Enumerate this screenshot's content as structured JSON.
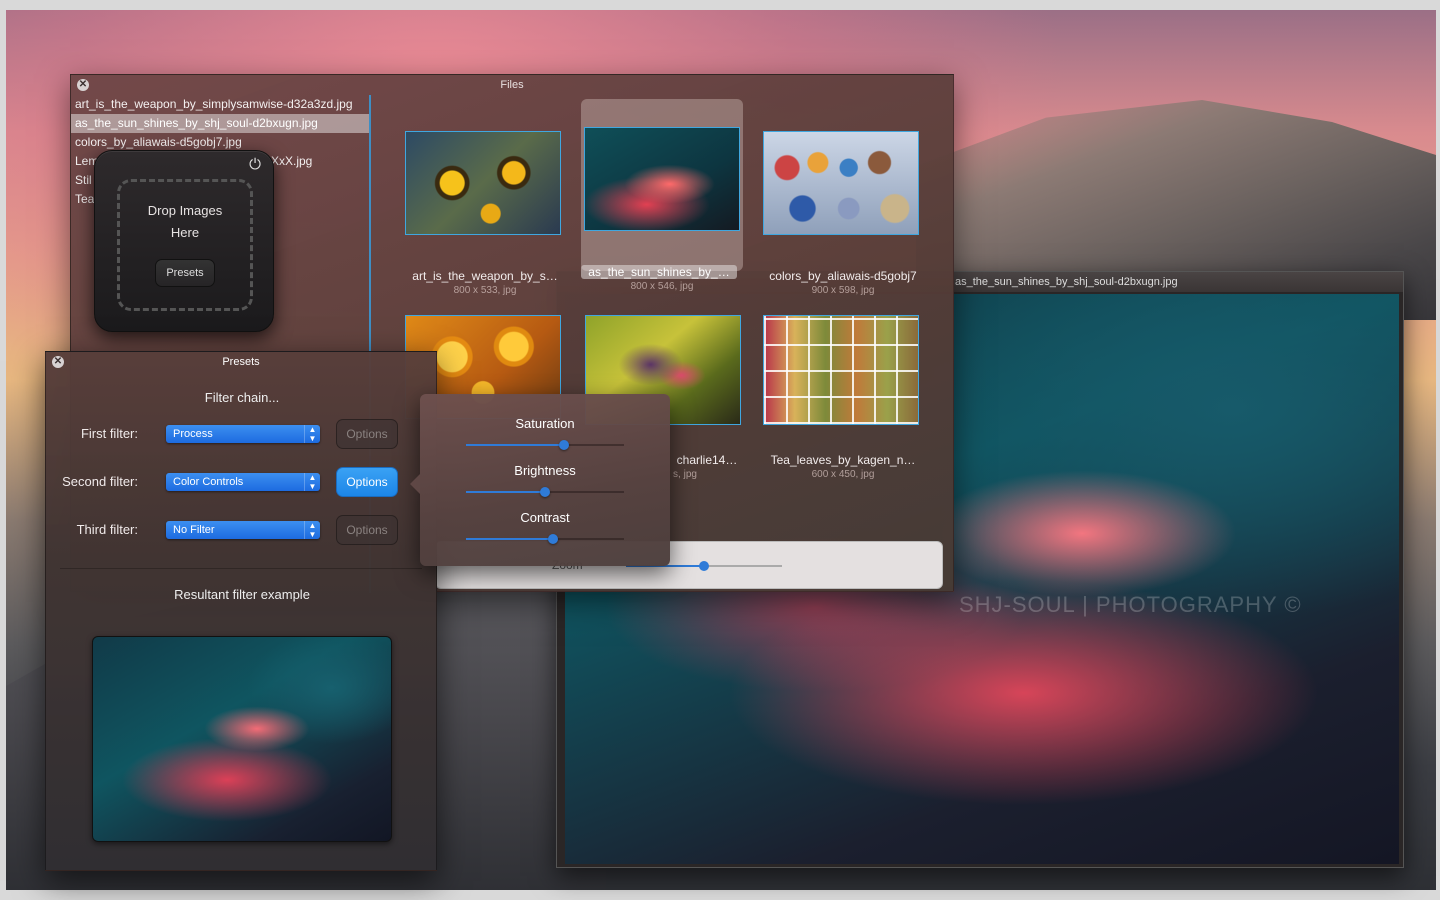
{
  "viewer": {
    "title": "as_the_sun_shines_by_shj_soul-d2bxugn.jpg",
    "watermark": "SHJ-SOUL | PHOTOGRAPHY ©"
  },
  "files_window": {
    "title": "Files",
    "files": [
      "art_is_the_weapon_by_simplysamwise-d32a3zd.jpg",
      "as_the_sun_shines_by_shj_soul-d2bxugn.jpg",
      "colors_by_aliawais-d5gobj7.jpg",
      "Lem",
      "Stil",
      "Tea"
    ],
    "file_list_trailing_fragment": "XxX.jpg",
    "thumbnails": [
      {
        "name": "art_is_the_weapon_by_s…",
        "meta": "800 x 533, jpg",
        "icon": "yellow-flowers"
      },
      {
        "name": "as_the_sun_shines_by_…",
        "meta": "800 x 546, jpg",
        "icon": "red-daisy"
      },
      {
        "name": "colors_by_aliawais-d5gobj7",
        "meta": "900 x 598, jpg",
        "icon": "pigment-jars"
      },
      {
        "name": "",
        "meta": "",
        "icon": "lemons"
      },
      {
        "name": "charlie14…",
        "meta": "s, jpg",
        "icon": "still-life"
      },
      {
        "name": "Tea_leaves_by_kagen_n…",
        "meta": "600 x 450, jpg",
        "icon": "tea-leaves"
      }
    ],
    "zoom": {
      "label": "Zoom",
      "value": 0.5
    }
  },
  "drop_zone": {
    "line1": "Drop Images",
    "line2": "Here",
    "presets_button": "Presets",
    "power_icon": "power-icon"
  },
  "presets_window": {
    "title": "Presets",
    "filter_chain_title": "Filter chain...",
    "filters": [
      {
        "label": "First filter:",
        "selected": "Process",
        "options_label": "Options",
        "active": false
      },
      {
        "label": "Second filter:",
        "selected": "Color Controls",
        "options_label": "Options",
        "active": true
      },
      {
        "label": "Third filter:",
        "selected": "No Filter",
        "options_label": "Options",
        "active": false
      }
    ],
    "result_title": "Resultant filter example"
  },
  "color_controls": {
    "sliders": [
      {
        "label": "Saturation",
        "value": 0.62
      },
      {
        "label": "Brightness",
        "value": 0.5
      },
      {
        "label": "Contrast",
        "value": 0.55
      }
    ]
  },
  "colors": {
    "accent": "#2f7bd8",
    "selection_border": "#3fa7e0"
  }
}
